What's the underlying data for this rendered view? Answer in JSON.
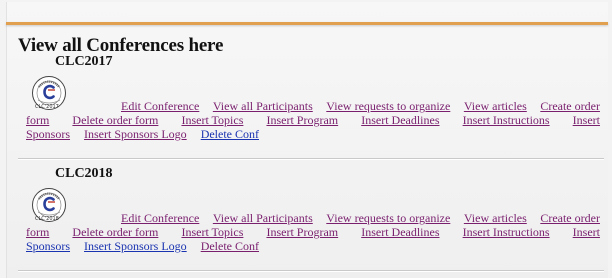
{
  "page": {
    "heading": "View all Conferences here"
  },
  "conferences": [
    {
      "title": "CLC2017",
      "logo_year": "CLC'2017",
      "links": {
        "edit": "Edit Conference",
        "participants": "View all Participants",
        "requests": "View requests to organize",
        "articles": "View articles",
        "create_order_part1": "Create order",
        "create_order_part2": "form",
        "delete_order": "Delete order form",
        "topics": "Insert Topics",
        "program": "Insert Program",
        "deadlines": "Insert Deadlines",
        "instructions": "Insert Instructions",
        "sponsors_part1": "Insert",
        "sponsors_part2": "Sponsors",
        "sponsors_logo": "Insert Sponsors Logo",
        "delete_conf": "Delete Conf"
      }
    },
    {
      "title": "CLC2018",
      "logo_year": "CLC'2018",
      "links": {
        "edit": "Edit Conference",
        "participants": "View all Participants",
        "requests": "View requests to organize",
        "articles": "View articles",
        "create_order_part1": "Create order",
        "create_order_part2": "form",
        "delete_order": "Delete order form",
        "topics": "Insert Topics",
        "program": "Insert Program",
        "deadlines": "Insert Deadlines",
        "instructions": "Insert Instructions",
        "sponsors_part1": "Insert",
        "sponsors_part2": "Sponsors",
        "sponsors_logo": "Insert Sponsors Logo",
        "delete_conf": "Delete Conf"
      }
    }
  ],
  "colors": {
    "accent_rule": "#e0a050",
    "visited_link": "#7a1f6e",
    "link": "#1a33b0"
  },
  "icons": {
    "conference_logo": "clc-logo-icon"
  }
}
